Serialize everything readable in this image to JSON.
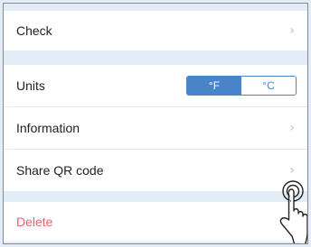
{
  "rows": {
    "check": {
      "label": "Check"
    },
    "units": {
      "label": "Units",
      "options": [
        "°F",
        "°C"
      ],
      "selected": "°F"
    },
    "information": {
      "label": "Information"
    },
    "share_qr": {
      "label": "Share QR code"
    },
    "delete": {
      "label": "Delete"
    }
  },
  "icons": {
    "chevron": "›",
    "hand": "hand-pointer-icon"
  },
  "colors": {
    "background": "#e3edf7",
    "accent": "#4a84c8",
    "delete": "#e0636b"
  }
}
